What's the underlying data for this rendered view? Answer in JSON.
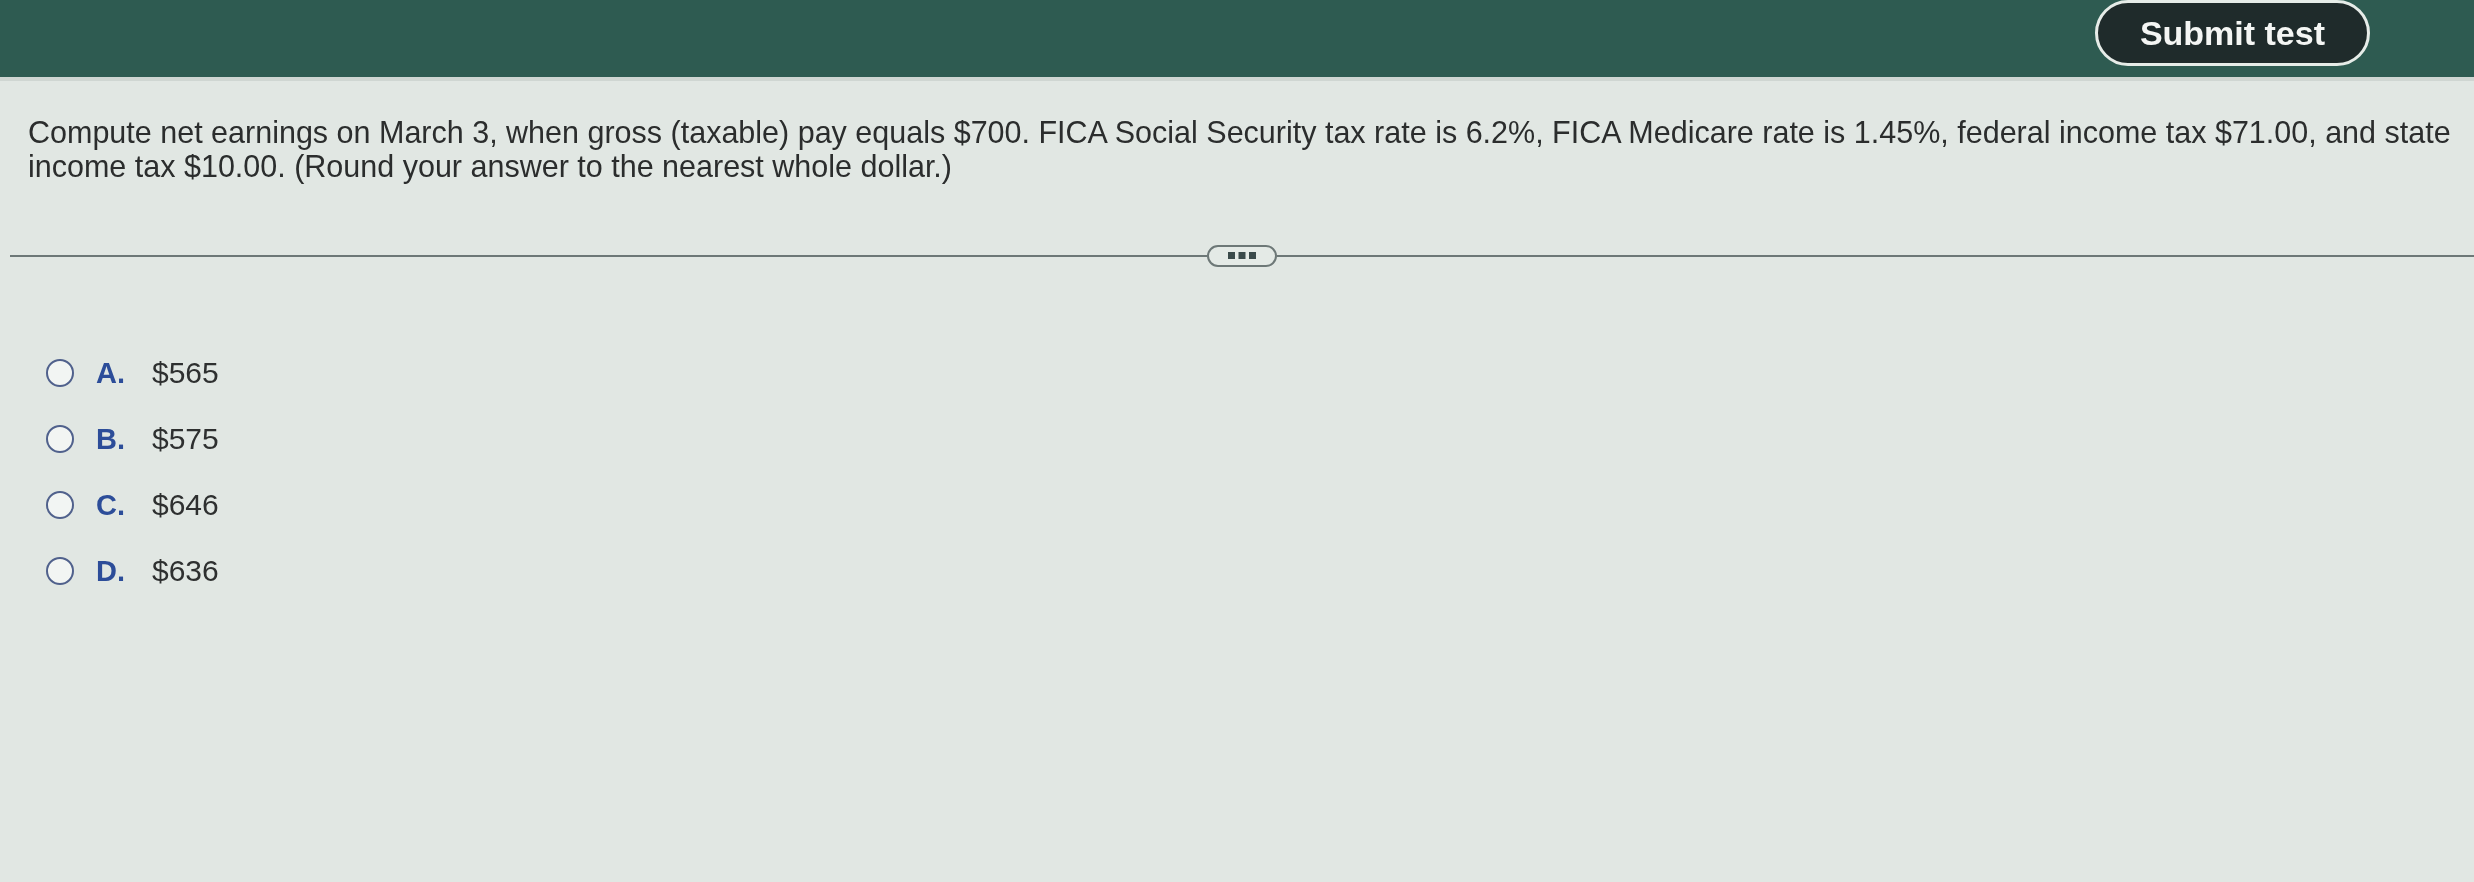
{
  "header": {
    "submit_button": "Submit test"
  },
  "question": {
    "text": "Compute net earnings on March 3, when gross (taxable) pay equals $700. FICA Social Security tax rate is 6.2%, FICA Medicare rate is 1.45%, federal income tax $71.00, and state income tax $10.00. (Round your answer to the nearest whole dollar.)"
  },
  "options": [
    {
      "letter": "A.",
      "value": "$565",
      "selected": false
    },
    {
      "letter": "B.",
      "value": "$575",
      "selected": false
    },
    {
      "letter": "C.",
      "value": "$646",
      "selected": false
    },
    {
      "letter": "D.",
      "value": "$636",
      "selected": false
    }
  ]
}
